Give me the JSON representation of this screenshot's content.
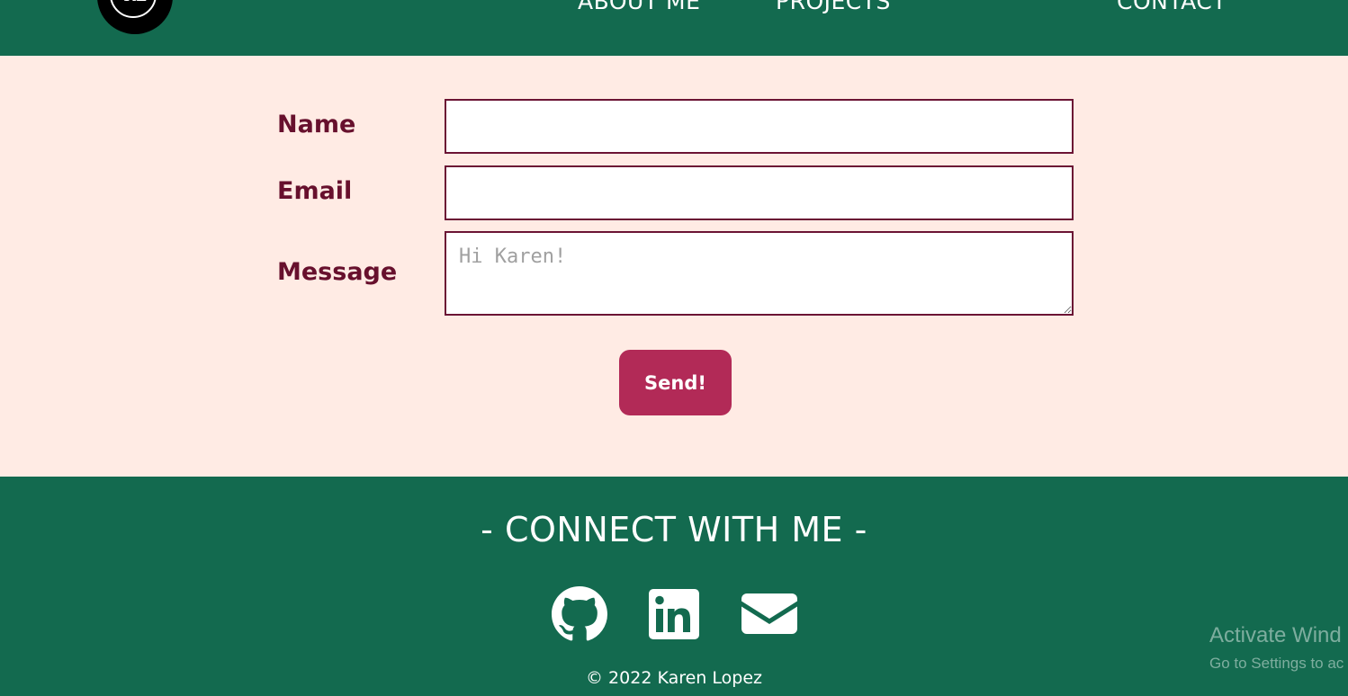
{
  "header": {
    "logo_text": "KL",
    "nav": {
      "about": "ABOUT ME",
      "projects": "PROJECTS",
      "contact": "CONTACT"
    }
  },
  "form": {
    "name_label": "Name",
    "email_label": "Email",
    "message_label": "Message",
    "name_value": "",
    "email_value": "",
    "message_placeholder": "Hi Karen!",
    "send_label": "Send!"
  },
  "footer": {
    "title": "- CONNECT WITH ME -",
    "icons": [
      "github-icon",
      "linkedin-icon",
      "envelope-icon"
    ],
    "copyright": "© 2022 Karen Lopez"
  },
  "watermark": {
    "title": "Activate Wind",
    "subtitle": "Go to Settings to ac"
  },
  "colors": {
    "header_bg": "#136a4f",
    "page_bg": "#ffebe4",
    "label": "#67102d",
    "field_border": "#6b1434",
    "button": "#b22a57"
  }
}
